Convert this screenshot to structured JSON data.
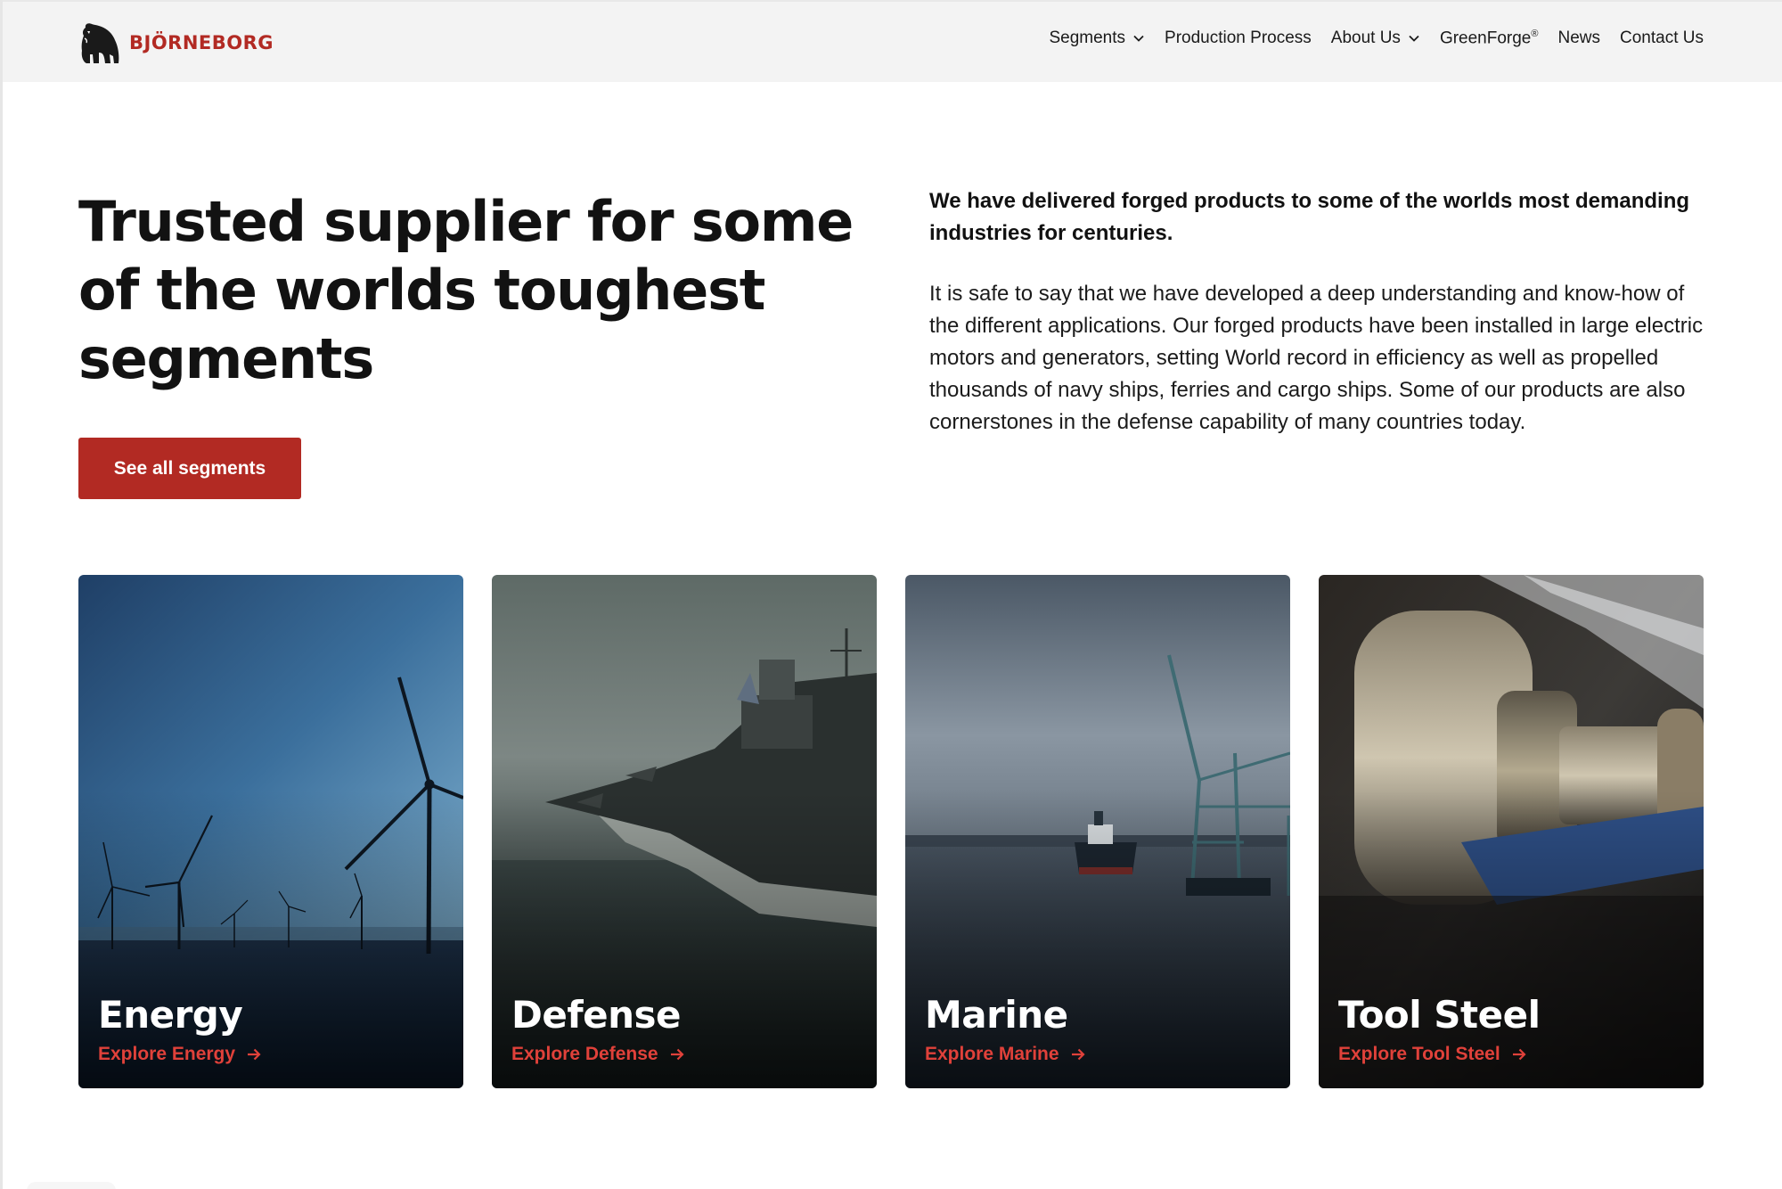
{
  "brand": {
    "name": "BJÖRNEBORG",
    "color": "#b22a23"
  },
  "nav": {
    "items": [
      {
        "label": "Segments",
        "has_dropdown": true
      },
      {
        "label": "Production Process",
        "has_dropdown": false
      },
      {
        "label": "About Us",
        "has_dropdown": true
      },
      {
        "label": "GreenForge",
        "mark": "®",
        "has_dropdown": false
      },
      {
        "label": "News",
        "has_dropdown": false
      },
      {
        "label": "Contact Us",
        "has_dropdown": false
      }
    ]
  },
  "hero": {
    "title": "Trusted supplier for some of the worlds toughest segments",
    "cta_label": "See all segments"
  },
  "intro": {
    "lead": "We have delivered forged products to some of the worlds most demanding industries for centuries.",
    "body": "It is safe to say that we have developed a deep understanding and know-how of the different applications. Our forged products have been installed in large electric motors and generators, setting World record in efficiency as well as propelled thousands of navy ships, ferries and cargo ships. Some of our products are also cornerstones in the defense capability of many countries today."
  },
  "segments": [
    {
      "title": "Energy",
      "link": "Explore Energy",
      "image": "offshore-wind-turbines"
    },
    {
      "title": "Defense",
      "link": "Explore Defense",
      "image": "aircraft-carrier"
    },
    {
      "title": "Marine",
      "link": "Explore Marine",
      "image": "cargo-ship-harbor-crane"
    },
    {
      "title": "Tool Steel",
      "link": "Explore Tool Steel",
      "image": "forged-steel-shaft"
    }
  ],
  "colors": {
    "accent": "#b22a23",
    "link_red": "#e0413a",
    "header_bg": "#f3f3f3"
  }
}
